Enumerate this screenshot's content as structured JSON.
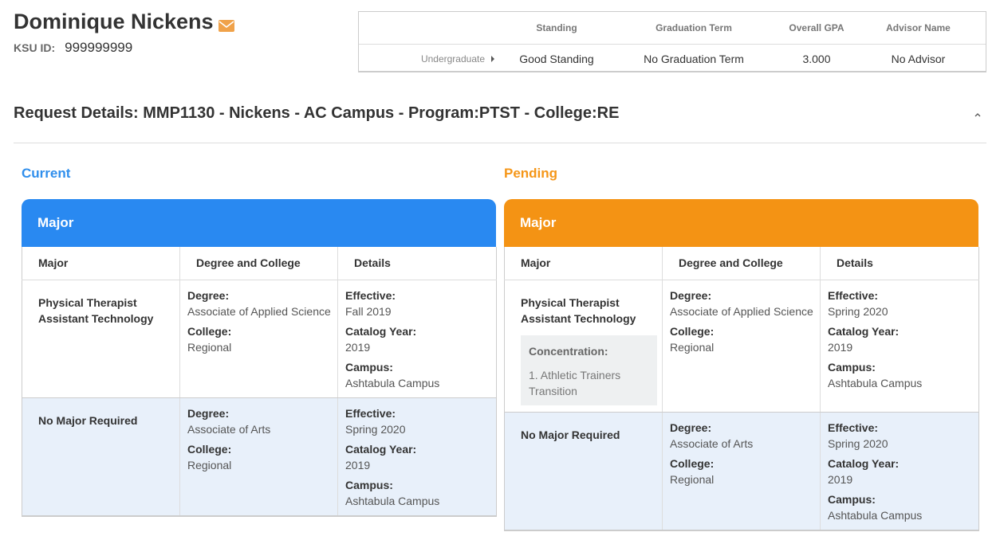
{
  "student": {
    "name": "Dominique Nickens",
    "ksu_label": "KSU ID:",
    "ksu_id": "999999999"
  },
  "summary": {
    "headers": [
      "Standing",
      "Graduation Term",
      "Overall GPA",
      "Advisor Name"
    ],
    "level": "Undergraduate",
    "standing": "Good Standing",
    "graduation_term": "No Graduation Term",
    "gpa": "3.000",
    "advisor": "No Advisor"
  },
  "request": {
    "title": "Request Details: MMP1130 - Nickens - AC Campus - Program:PTST - College:RE"
  },
  "current": {
    "title": "Current",
    "panel_title": "Major",
    "color": "#2989f1",
    "columns": [
      "Major",
      "Degree and College",
      "Details"
    ],
    "rows": [
      {
        "major": "Physical Therapist Assistant Technology",
        "degree_label": "Degree:",
        "degree": "Associate of Applied Science",
        "college_label": "College:",
        "college": "Regional",
        "effective_label": "Effective:",
        "effective": "Fall 2019",
        "catalog_label": "Catalog Year:",
        "catalog": "2019",
        "campus_label": "Campus:",
        "campus": "Ashtabula Campus"
      },
      {
        "major": "No Major Required",
        "degree_label": "Degree:",
        "degree": "Associate of Arts",
        "college_label": "College:",
        "college": "Regional",
        "effective_label": "Effective:",
        "effective": "Spring 2020",
        "catalog_label": "Catalog Year:",
        "catalog": "2019",
        "campus_label": "Campus:",
        "campus": "Ashtabula Campus"
      }
    ]
  },
  "pending": {
    "title": "Pending",
    "panel_title": "Major",
    "color": "#f49314",
    "columns": [
      "Major",
      "Degree and College",
      "Details"
    ],
    "rows": [
      {
        "major": "Physical Therapist Assistant Technology",
        "concentration_label": "Concentration:",
        "concentration_item": "1.  Athletic Trainers Transition",
        "degree_label": "Degree:",
        "degree": "Associate of Applied Science",
        "college_label": "College:",
        "college": "Regional",
        "effective_label": "Effective:",
        "effective": "Spring 2020",
        "catalog_label": "Catalog Year:",
        "catalog": "2019",
        "campus_label": "Campus:",
        "campus": "Ashtabula Campus"
      },
      {
        "major": "No Major Required",
        "degree_label": "Degree:",
        "degree": "Associate of Arts",
        "college_label": "College:",
        "college": "Regional",
        "effective_label": "Effective:",
        "effective": "Spring 2020",
        "catalog_label": "Catalog Year:",
        "catalog": "2019",
        "campus_label": "Campus:",
        "campus": "Ashtabula Campus"
      }
    ]
  },
  "icons": {
    "mail": "envelope-icon",
    "level_toggle": "caret-right-icon",
    "collapse": "chevron-up-icon"
  }
}
